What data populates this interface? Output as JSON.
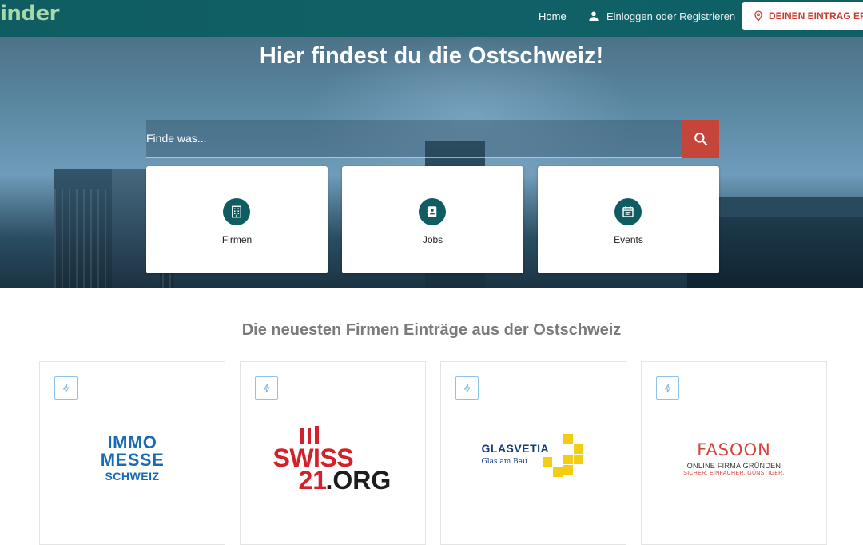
{
  "nav": {
    "logo_text": "inder",
    "home_label": "Home",
    "login_label": "Einloggen oder Registrieren",
    "cta_label": "DEINEN EINTRAG ER",
    "colors": {
      "bar": "#106167",
      "logo": "#a6d8a9",
      "cta_text": "#c93a2f"
    },
    "icons": {
      "login": "person-icon",
      "cta": "map-pin-icon"
    }
  },
  "hero": {
    "title": "Hier findest du die Ostschweiz!",
    "search": {
      "placeholder": "Finde was...",
      "value": "",
      "button_icon": "search-icon",
      "button_color": "#c6453a"
    },
    "categories": [
      {
        "label": "Firmen",
        "icon": "building-icon"
      },
      {
        "label": "Jobs",
        "icon": "contact-card-icon"
      },
      {
        "label": "Events",
        "icon": "calendar-icon"
      }
    ]
  },
  "section": {
    "title": "Die neuesten Firmen Einträge aus der Ostschweiz",
    "companies": [
      {
        "badge_icon": "bolt-icon",
        "logo_lines": [
          "IMMO",
          "MESSE",
          "SCHWEIZ"
        ]
      },
      {
        "badge_icon": "bolt-icon",
        "logo_lines": [
          "SWISS",
          "21",
          ".ORG"
        ]
      },
      {
        "badge_icon": "bolt-icon",
        "logo_lines": [
          "GLASVETIA",
          "Glas am Bau"
        ]
      },
      {
        "badge_icon": "bolt-icon",
        "logo_lines": [
          "FASOON",
          "ONLINE FIRMA GRÜNDEN",
          "SICHER. EINFACHER. GÜNSTIGER."
        ]
      }
    ]
  }
}
